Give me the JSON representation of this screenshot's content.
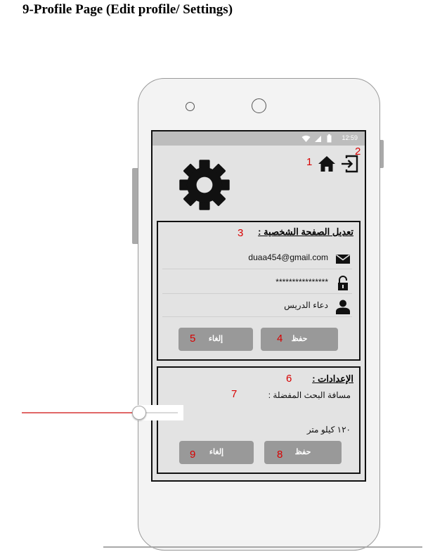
{
  "doc_title": "9-Profile Page (Edit profile/ Settings)",
  "status_bar": {
    "time": "12:59"
  },
  "profile": {
    "title": "تعديل الصفحة الشخصية :",
    "email": "duaa454@gmail.com",
    "password": "****************",
    "name": "دعاء الدريس",
    "save_label": "حفظ",
    "cancel_label": "إلغاء"
  },
  "settings": {
    "title": "الإعدادات :",
    "distance_label": "مسافة البحث المفضلة :",
    "distance_value_text": "١٢٠ كيلو متر",
    "slider_fraction": 0.75,
    "save_label": "حفظ",
    "cancel_label": "إلغاء"
  },
  "annotations": [
    "1",
    "2",
    "3",
    "4",
    "5",
    "6",
    "7",
    "8",
    "9"
  ],
  "colors": {
    "annotation": "#d80000",
    "slider_fill": "#e06666",
    "button": "#999999"
  },
  "icons": [
    "gear-icon",
    "home-icon",
    "logout-icon",
    "mail-icon",
    "lock-icon",
    "user-icon",
    "wifi-icon",
    "signal-icon",
    "battery-icon"
  ]
}
